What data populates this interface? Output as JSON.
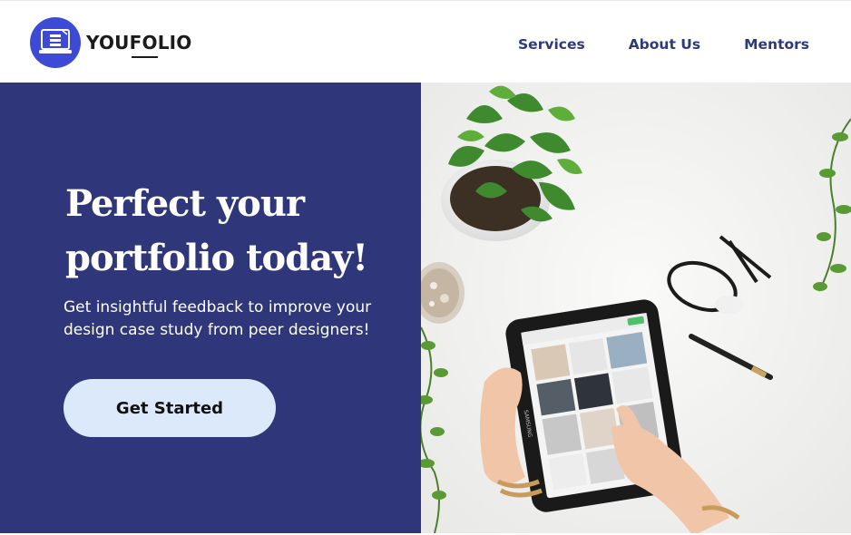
{
  "brand": {
    "prefix": "YOU",
    "middle": "FO",
    "suffix": "LIO",
    "icon": "laptop-layers-icon",
    "color": "#3d4ad6"
  },
  "nav": {
    "items": [
      "Services",
      "About Us",
      "Mentors"
    ],
    "color": "#2f3878"
  },
  "hero": {
    "headline_line1": "Perfect your",
    "headline_line2": "portfolio today!",
    "subtitle_line1": "Get insightful feedback to improve your",
    "subtitle_line2": "design case study from peer designers!",
    "cta_label": "Get Started",
    "background": "#2f377a",
    "cta_background": "#dce9fb"
  },
  "photo": {
    "subject": "hands-holding-tablet-with-plants-and-glasses",
    "tablet_brand": "SAMSUNG"
  }
}
